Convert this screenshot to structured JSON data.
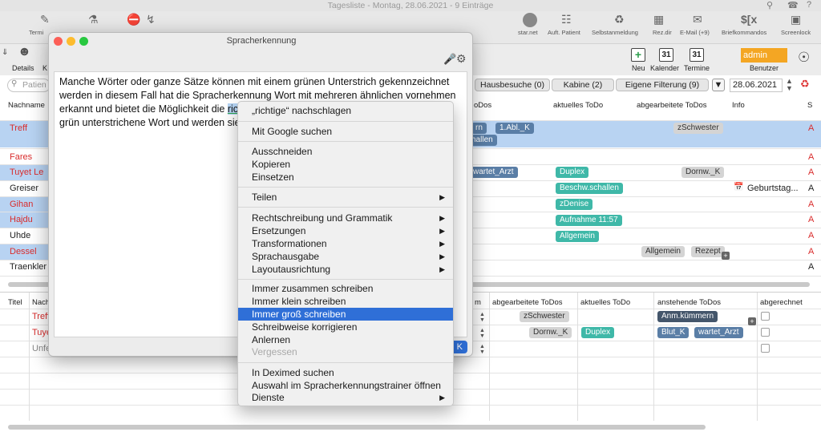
{
  "window": {
    "title": "Tagesliste - Montag, 28.06.2021 - 9 Einträge"
  },
  "toolbar": {
    "left_label": "Termi",
    "right": [
      "star.net",
      "Auft. Patient",
      "Selbstanmeldung",
      "Rez.dir",
      "E-Mail (+9)",
      "Briefkommandos",
      "Screenlock"
    ],
    "row2_left": [
      "Details",
      "K"
    ],
    "new_label": "Neu",
    "calendar_label": "Kalender",
    "termine_label": "Termine",
    "calendar_day": "31",
    "user_value": "admin",
    "user_label": "Benutzer"
  },
  "search": {
    "placeholder": "Patien"
  },
  "filters": {
    "tabs": [
      "Hausbesuche (0)",
      "Kabine (2)",
      "Eigene Filterung (9)"
    ],
    "date": "28.06.2021"
  },
  "table1": {
    "headers": {
      "name": "Nachname",
      "todos": "oDos",
      "aktuell": "aktuelles ToDo",
      "bearbeitet": "abgearbeitete ToDos",
      "info": "Info",
      "s": "S"
    },
    "names": [
      "Treff",
      "Fares",
      "Tuyet Le",
      "Greiser",
      "Gihan",
      "Hajdu",
      "Uhde",
      "Dessel",
      "Traenkler"
    ],
    "tags": {
      "r1a": "rn",
      "r1b": "1.Abl._K",
      "r1c": "zSchwester",
      "r1d": "challen",
      "r3a": "wartet_Arzt",
      "r3b": "Duplex",
      "r3c": "Dornw._K",
      "r4a": "Beschw.schallen",
      "r4info": "Geburtstag...",
      "r5a": "zDenise",
      "r6a": "Aufnahme 11:57",
      "r7a": "Allgemein",
      "r8a": "Allgemein",
      "r8b": "Rezept"
    }
  },
  "table2": {
    "headers": {
      "titel": "Titel",
      "nach": "Nach",
      "m": "m",
      "bearbeitet": "abgearbeitete ToDos",
      "aktuell": "aktuelles ToDo",
      "anstehend": "anstehende ToDos",
      "abgerechnet": "abgerechnet"
    },
    "names": [
      "Treff",
      "Tuye",
      "Unfe"
    ],
    "tags": {
      "r1a": "zSchwester",
      "r1b": "Anm.kümmern",
      "r2a": "Dornw._K",
      "r2b": "Duplex",
      "r2c": "Blut_K",
      "r2d": "wartet_Arzt"
    }
  },
  "dialog": {
    "title": "Spracherkennung",
    "text_lines": [
      "Manche Wörter oder ganze Sätze können mit einem grünen Unterstrich gekennzeichnet",
      "werden in diesem Fall hat die Spracherkennung Wort mit mehreren ähnlichen vornehmen",
      "erkannt und bietet die Möglichkeit die ",
      "grün unterstrichene Wort und werden sie"
    ],
    "highlight_word": "rich",
    "ok_fragment": "K"
  },
  "context_menu": {
    "items": [
      {
        "label": "„richtige“ nachschlagen"
      },
      {
        "label": "Mit Google suchen"
      },
      {
        "label": "Ausschneiden"
      },
      {
        "label": "Kopieren"
      },
      {
        "label": "Einsetzen"
      },
      {
        "label": "Teilen"
      },
      {
        "label": "Rechtschreibung und Grammatik"
      },
      {
        "label": "Ersetzungen"
      },
      {
        "label": "Transformationen"
      },
      {
        "label": "Sprachausgabe"
      },
      {
        "label": "Layoutausrichtung"
      },
      {
        "label": "Immer zusammen schreiben"
      },
      {
        "label": "Immer klein schreiben"
      },
      {
        "label": "Immer groß schreiben"
      },
      {
        "label": "Schreibweise korrigieren"
      },
      {
        "label": "Anlernen"
      },
      {
        "label": "Vergessen"
      },
      {
        "label": "In Deximed suchen"
      },
      {
        "label": "Auswahl im Spracherkennungstrainer öffnen"
      },
      {
        "label": "Dienste"
      }
    ]
  }
}
